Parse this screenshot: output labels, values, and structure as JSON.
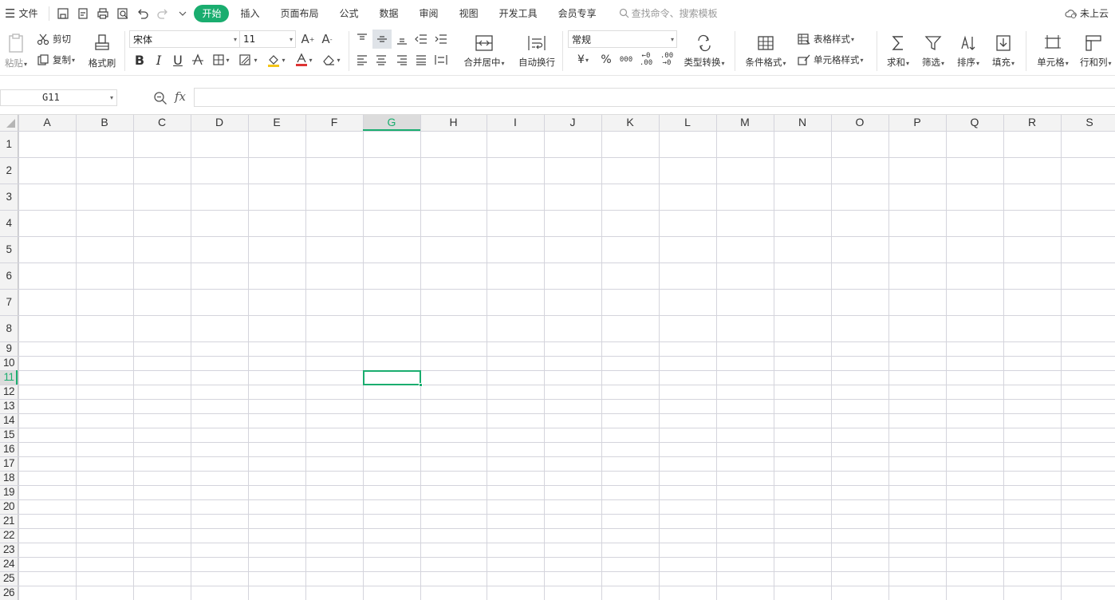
{
  "menubar": {
    "file_label": "文件",
    "tabs": [
      "开始",
      "插入",
      "页面布局",
      "公式",
      "数据",
      "审阅",
      "视图",
      "开发工具",
      "会员专享"
    ],
    "active_tab": "开始",
    "search_placeholder": "查找命令、搜索模板",
    "cloud_label": "未上云"
  },
  "toolbar": {
    "paste": "粘贴",
    "cut": "剪切",
    "copy": "复制",
    "format_painter": "格式刷",
    "font_name": "宋体",
    "font_size": "11",
    "merge_center": "合并居中",
    "wrap_text": "自动换行",
    "number_format": "常规",
    "type_convert": "类型转换",
    "conditional_format": "条件格式",
    "table_style": "表格样式",
    "cell_style": "单元格样式",
    "sum": "求和",
    "filter": "筛选",
    "sort": "排序",
    "fill": "填充",
    "cell": "单元格",
    "row_col": "行和列",
    "bold": "B",
    "italic": "I",
    "underline": "U",
    "currency": "¥",
    "percent": "%"
  },
  "formula_bar": {
    "name_box": "G11",
    "fx_label": "fx",
    "formula": ""
  },
  "sheet": {
    "columns": [
      "A",
      "B",
      "C",
      "D",
      "E",
      "F",
      "G",
      "H",
      "I",
      "J",
      "K",
      "L",
      "M",
      "N",
      "O",
      "P",
      "Q",
      "R",
      "S"
    ],
    "rows": [
      "1",
      "2",
      "3",
      "4",
      "5",
      "6",
      "7",
      "8",
      "9",
      "10",
      "11",
      "12",
      "13",
      "14",
      "15",
      "16",
      "17",
      "18",
      "19",
      "20",
      "21",
      "22",
      "23",
      "24",
      "25",
      "26"
    ],
    "selected_cell": "G11",
    "selected_column": "G",
    "selected_row": "11"
  },
  "colors": {
    "accent": "#1aad6f",
    "grid_line": "#d4d4dc",
    "header_bg": "#f3f3f3",
    "selection_header_bg": "#dcdcdc"
  }
}
